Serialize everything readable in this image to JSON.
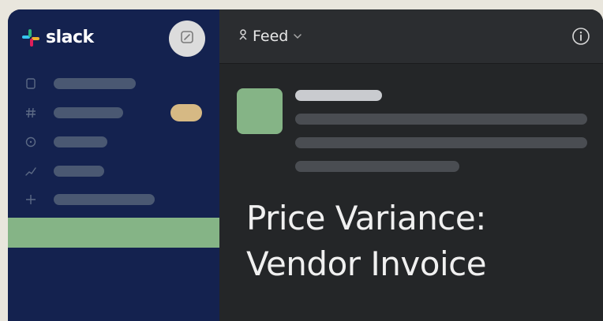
{
  "app": {
    "brand": "slack"
  },
  "topbar": {
    "title": "Feed",
    "title_icon": "bookmark-icon",
    "dropdown_icon": "chevron-down-icon",
    "info_icon": "info-icon"
  },
  "sidebar": {
    "compose_icon": "compose-icon",
    "items": [
      {
        "icon": "document-icon"
      },
      {
        "icon": "hash-icon"
      },
      {
        "icon": "clock-icon"
      },
      {
        "icon": "activity-icon"
      },
      {
        "icon": "plus-icon"
      }
    ]
  },
  "overlay": {
    "line1": "Price Variance:",
    "line2": "Vendor Invoice"
  },
  "colors": {
    "sidebar_bg": "#14224f",
    "accent_green": "#85b486",
    "badge": "#d6b984",
    "main_bg": "#242628"
  }
}
